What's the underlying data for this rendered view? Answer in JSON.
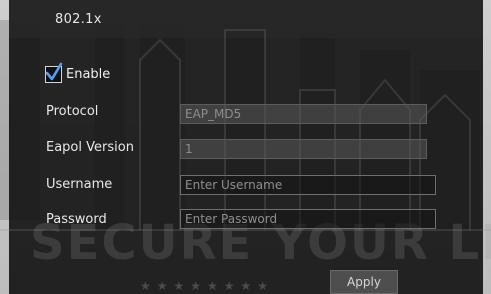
{
  "dialog": {
    "title": "802.1x"
  },
  "enable": {
    "label": "Enable",
    "checked": true
  },
  "form": {
    "protocol": {
      "label": "Protocol",
      "value": "EAP_MD5"
    },
    "eapol_version": {
      "label": "Eapol Version",
      "value": "1"
    },
    "username": {
      "label": "Username",
      "placeholder": "Enter Username",
      "value": ""
    },
    "password": {
      "label": "Password",
      "placeholder": "Enter Password",
      "value": ""
    }
  },
  "actions": {
    "apply_label": "Apply"
  },
  "background": {
    "watermark_text": "SECURE YOUR LI"
  }
}
